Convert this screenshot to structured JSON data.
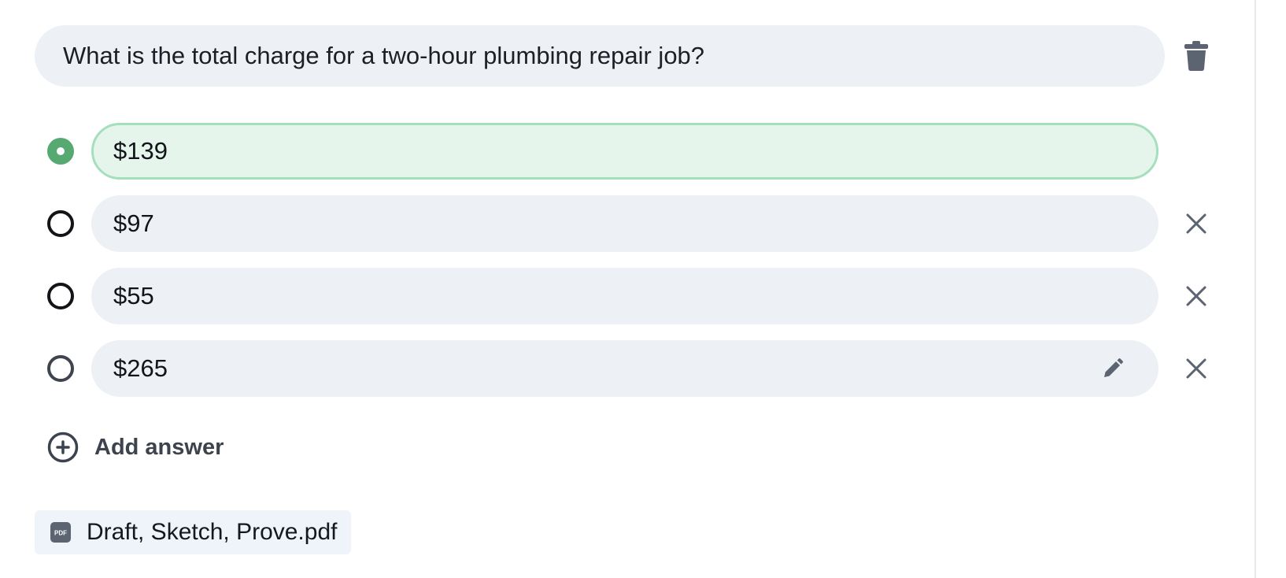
{
  "question": {
    "text": "What is the total charge for a two-hour plumbing repair job?"
  },
  "answers": [
    {
      "label": "$139",
      "correct": true
    },
    {
      "label": "$97",
      "correct": false
    },
    {
      "label": "$55",
      "correct": false
    },
    {
      "label": "$265",
      "correct": false
    }
  ],
  "add_answer": {
    "label": "Add answer"
  },
  "attachment": {
    "name": "Draft, Sketch, Prove.pdf",
    "badge": "PDF"
  },
  "colors": {
    "correct_accent": "#56a970",
    "correct_fill": "#e6f5ec",
    "correct_border": "#a5dfbd",
    "field_fill": "#edf1f5",
    "icon_gray": "#5b6470"
  },
  "icons": {
    "delete": "trash-icon",
    "remove": "close-icon",
    "edit": "pencil-icon",
    "add": "plus-circle-icon",
    "file": "pdf-icon"
  }
}
